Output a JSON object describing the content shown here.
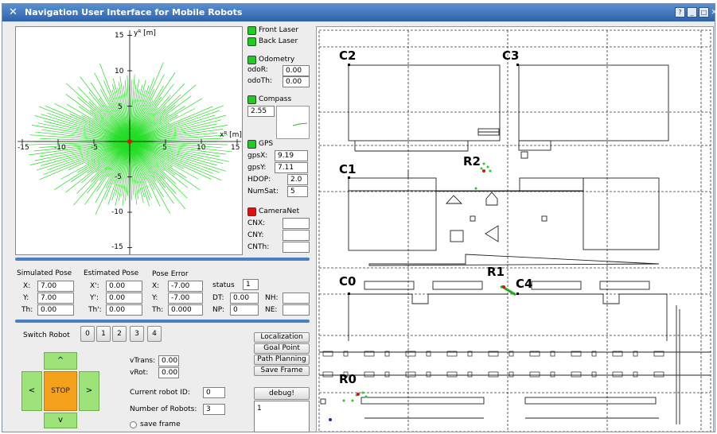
{
  "window": {
    "title": "Navigation User Interface for Mobile Robots",
    "buttons": [
      "?",
      "_",
      "□",
      "×"
    ]
  },
  "laser_plot": {
    "y_axis_label": "yᴿ [m]",
    "x_axis_label": "xᴿ [m]",
    "x_ticks": [
      "-15",
      "-10",
      "-5",
      "0",
      "5",
      "10",
      "15"
    ],
    "y_ticks": [
      "15",
      "10",
      "5",
      "-5",
      "-10",
      "-15"
    ]
  },
  "sensors": {
    "front_laser": {
      "label": "Front Laser",
      "status_color": "#22cc22"
    },
    "back_laser": {
      "label": "Back Laser",
      "status_color": "#22cc22"
    },
    "odometry": {
      "label": "Odometry",
      "status_color": "#22cc22",
      "odoR_label": "odoR:",
      "odoR": "0.00",
      "odoTh_label": "odoTh:",
      "odoTh": "0.00"
    },
    "compass": {
      "label": "Compass",
      "status_color": "#22cc22",
      "value": "2.55"
    },
    "gps": {
      "label": "GPS",
      "status_color": "#22cc22",
      "gpsX_label": "gpsX:",
      "gpsX": "9.19",
      "gpsY_label": "gpsY:",
      "gpsY": "7.11",
      "hdop_label": "HDOP:",
      "hdop": "2.0",
      "numsat_label": "NumSat:",
      "numsat": "5"
    },
    "cameranet": {
      "label": "CameraNet",
      "status_color": "#dd1111",
      "cnx_label": "CNX:",
      "cnx": "",
      "cny_label": "CNY:",
      "cny": "",
      "cnth_label": "CNTh:",
      "cnth": ""
    }
  },
  "pose": {
    "simulated": {
      "heading": "Simulated Pose",
      "x_label": "X:",
      "x": "7.00",
      "y_label": "Y:",
      "y": "7.00",
      "th_label": "Th:",
      "th": "0.00"
    },
    "estimated": {
      "heading": "Estimated Pose",
      "x_label": "X':",
      "x": "0.00",
      "y_label": "Y':",
      "y": "0.00",
      "th_label": "Th':",
      "th": "0.00"
    },
    "error": {
      "heading": "Pose Error",
      "x_label": "X:",
      "x": "-7.00",
      "y_label": "Y:",
      "y": "-7.00",
      "th_label": "Th:",
      "th": "0.000"
    },
    "status_label": "status",
    "status": "1",
    "dt_label": "DT:",
    "dt": "0.00",
    "np_label": "NP:",
    "np": "0",
    "nh_label": "NH:",
    "nh": "",
    "ne_label": "NE:",
    "ne": ""
  },
  "control": {
    "switch_robot_label": "Switch Robot",
    "robot_buttons": [
      "0",
      "1",
      "2",
      "3",
      "4"
    ],
    "up": "^",
    "down": "v",
    "left": "<",
    "right": ">",
    "stop": "STOP",
    "vtrans_label": "vTrans:",
    "vtrans": "0.00",
    "vrot_label": "vRot:",
    "vrot": "0.00",
    "current_robot_label": "Current robot ID:",
    "current_robot": "0",
    "num_robots_label": "Number of Robots:",
    "num_robots": "3",
    "save_frame_label": "save frame",
    "actions": [
      "Localization",
      "Goal Point",
      "Path Planning",
      "Save Frame"
    ],
    "debug_label": "debug!",
    "debug_text": "1"
  },
  "map": {
    "corner_labels": [
      "C0",
      "C1",
      "C2",
      "C3",
      "C4"
    ],
    "robot_labels": [
      "R0",
      "R1",
      "R2"
    ]
  },
  "colors": {
    "accent": "#4b7fc0",
    "laser": "#22dd22",
    "stop": "#f5a01a",
    "arrows": "#9ee27a"
  }
}
